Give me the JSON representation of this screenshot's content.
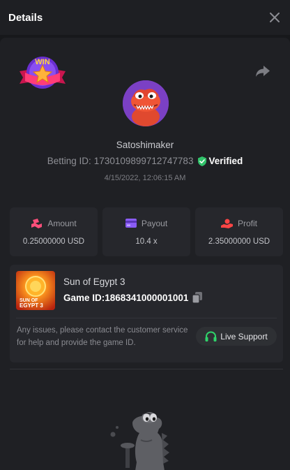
{
  "header": {
    "title": "Details"
  },
  "player": {
    "username": "Satoshimaker",
    "betting_id_label": "Betting ID:",
    "betting_id": "1730109899712747783",
    "verified_label": "Verified",
    "timestamp": "4/15/2022, 12:06:15 AM"
  },
  "stats": {
    "amount_label": "Amount",
    "amount_value": "0.25000000 USD",
    "payout_label": "Payout",
    "payout_value": "10.4 x",
    "profit_label": "Profit",
    "profit_value": "2.35000000 USD"
  },
  "game": {
    "name": "Sun of Egypt 3",
    "game_id_label": "Game ID:",
    "game_id": "1868341000001001",
    "help_text": "Any issues, please contact the customer service for help and provide the game ID.",
    "support_label": "Live Support"
  },
  "badge": {
    "text": "WIN"
  },
  "thumbnail": {
    "line1": "SUN OF",
    "line2": "EGYPT 3"
  },
  "colors": {
    "background": "#17181b",
    "panel": "#1f2024",
    "card": "#26272c",
    "verified_green": "#31c26a",
    "amount_pink": "#ff4f7b",
    "payout_purple": "#8a5cf5",
    "profit_red": "#ff4545",
    "support_green": "#2fd36a"
  },
  "icons": {
    "close": "close-icon",
    "share": "share-icon",
    "verified": "shield-check-icon",
    "amount": "amount-icon",
    "payout": "wallet-card-icon",
    "profit": "hand-coin-icon",
    "copy": "copy-icon",
    "support": "headset-icon"
  }
}
